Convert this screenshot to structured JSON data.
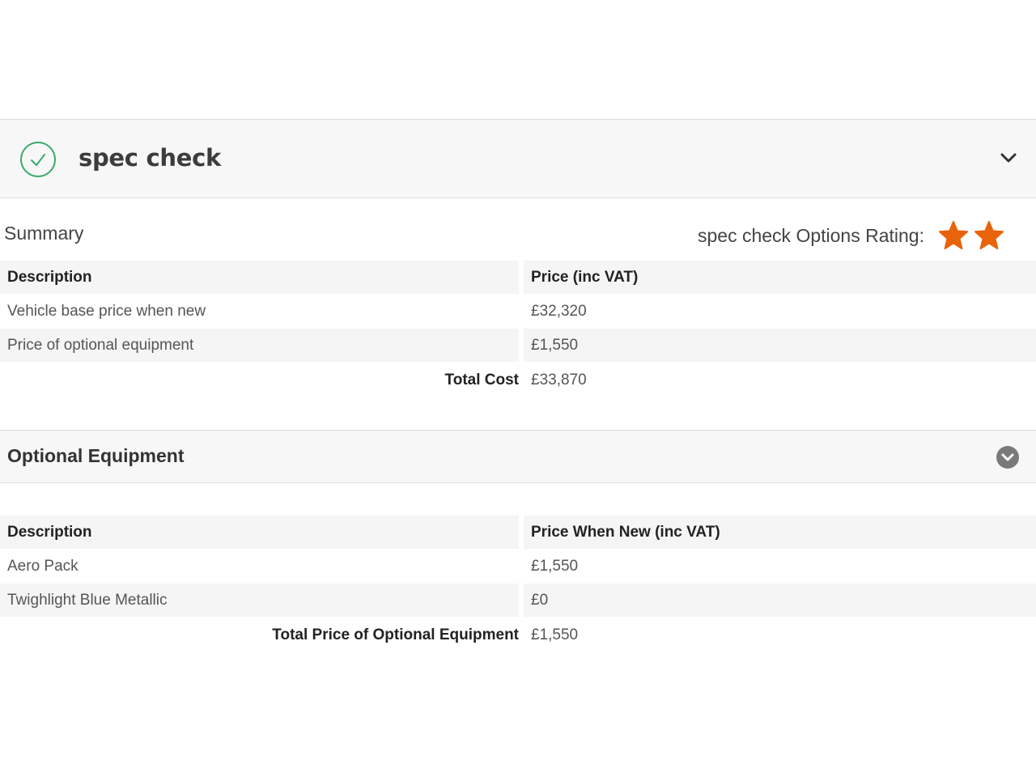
{
  "spec_check": {
    "title": "spec check"
  },
  "summary": {
    "label": "Summary",
    "rating_label": "spec check Options Rating:",
    "rating_stars": 2,
    "star_color": "#e8630a",
    "columns": [
      "Description",
      "Price (inc VAT)"
    ],
    "rows": [
      {
        "description": "Vehicle base price when new",
        "price": "£32,320"
      },
      {
        "description": "Price of optional equipment",
        "price": "£1,550"
      }
    ],
    "total_label": "Total Cost",
    "total_value": "£33,870"
  },
  "optional_equipment": {
    "title": "Optional Equipment",
    "columns": [
      "Description",
      "Price When New (inc VAT)"
    ],
    "rows": [
      {
        "description": "Aero Pack",
        "price": "£1,550"
      },
      {
        "description": "Twighlight Blue Metallic",
        "price": "£0"
      }
    ],
    "total_label": "Total Price of Optional Equipment",
    "total_value": "£1,550"
  },
  "colors": {
    "check_green": "#3aaa6a",
    "header_bg": "#f7f7f7",
    "row_shade": "#f5f5f5"
  }
}
